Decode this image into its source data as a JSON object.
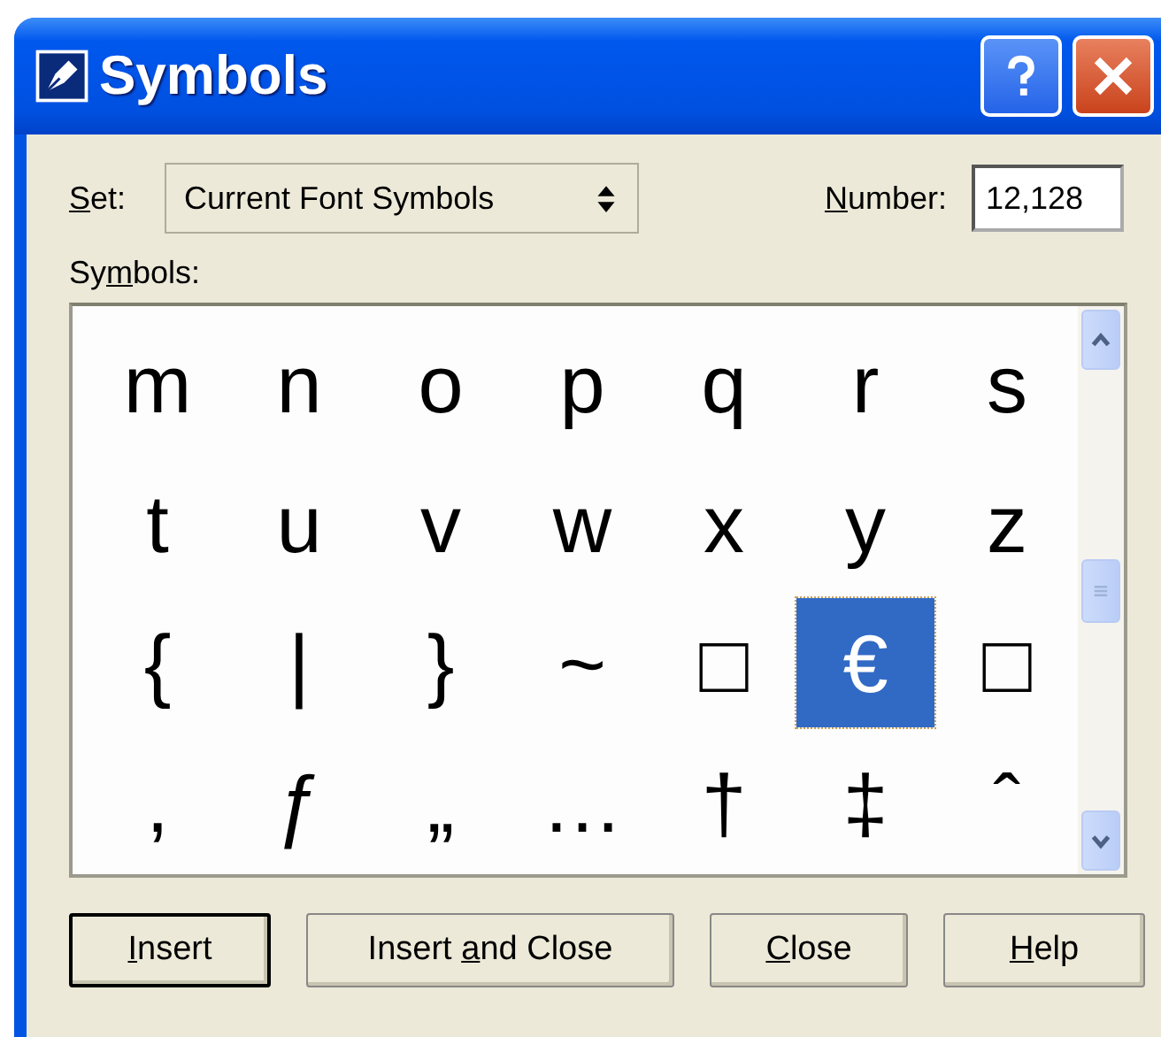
{
  "window": {
    "title": "Symbols"
  },
  "set": {
    "label": {
      "key": "S",
      "post": "et:"
    },
    "value": "Current Font Symbols"
  },
  "number": {
    "label": {
      "key": "N",
      "post": "umber:"
    },
    "value": "12,128"
  },
  "symbols_label": {
    "pre": "Sy",
    "key": "m",
    "post": "bols:"
  },
  "grid": [
    [
      {
        "char": "m",
        "selected": false
      },
      {
        "char": "n",
        "selected": false
      },
      {
        "char": "o",
        "selected": false
      },
      {
        "char": "p",
        "selected": false
      },
      {
        "char": "q",
        "selected": false
      },
      {
        "char": "r",
        "selected": false
      },
      {
        "char": "s",
        "selected": false
      }
    ],
    [
      {
        "char": "t",
        "selected": false
      },
      {
        "char": "u",
        "selected": false
      },
      {
        "char": "v",
        "selected": false
      },
      {
        "char": "w",
        "selected": false
      },
      {
        "char": "x",
        "selected": false
      },
      {
        "char": "y",
        "selected": false
      },
      {
        "char": "z",
        "selected": false
      }
    ],
    [
      {
        "char": "{",
        "selected": false
      },
      {
        "char": "|",
        "selected": false
      },
      {
        "char": "}",
        "selected": false
      },
      {
        "char": "~",
        "selected": false
      },
      {
        "char": "□",
        "selected": false
      },
      {
        "char": "€",
        "selected": true
      },
      {
        "char": "□",
        "selected": false
      }
    ],
    [
      {
        "char": ",",
        "selected": false
      },
      {
        "char": "ƒ",
        "selected": false
      },
      {
        "char": "„",
        "selected": false
      },
      {
        "char": "…",
        "selected": false
      },
      {
        "char": "†",
        "selected": false
      },
      {
        "char": "‡",
        "selected": false
      },
      {
        "char": "ˆ",
        "selected": false
      }
    ]
  ],
  "buttons": [
    {
      "key": "I",
      "post": "nsert",
      "default": true
    },
    {
      "pre": "Insert ",
      "key": "a",
      "post": "nd Close",
      "default": false
    },
    {
      "key": "C",
      "post": "lose",
      "default": false
    },
    {
      "key": "H",
      "post": "elp",
      "default": false
    }
  ]
}
